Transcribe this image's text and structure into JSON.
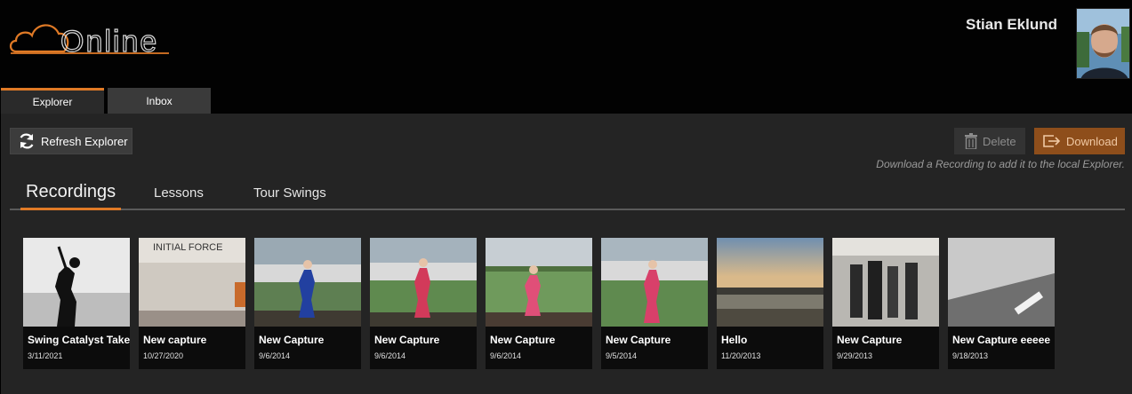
{
  "app": {
    "logo_text": "Online"
  },
  "user": {
    "name": "Stian Eklund"
  },
  "tabs": [
    {
      "label": "Explorer",
      "active": true
    },
    {
      "label": "Inbox",
      "active": false
    }
  ],
  "toolbar": {
    "refresh_label": "Refresh Explorer",
    "delete_label": "Delete",
    "download_label": "Download",
    "hint": "Download a Recording to add it to the local Explorer."
  },
  "subtabs": [
    {
      "label": "Recordings",
      "active": true
    },
    {
      "label": "Lessons",
      "active": false
    },
    {
      "label": "Tour Swings",
      "active": false
    }
  ],
  "recordings": [
    {
      "title": "Swing Catalyst Take",
      "date": "3/11/2021"
    },
    {
      "title": "New capture",
      "date": "10/27/2020",
      "thumb_text": "INITIAL FORCE"
    },
    {
      "title": "New Capture",
      "date": "9/6/2014"
    },
    {
      "title": "New Capture",
      "date": "9/6/2014"
    },
    {
      "title": "New Capture",
      "date": "9/6/2014"
    },
    {
      "title": "New Capture",
      "date": "9/5/2014"
    },
    {
      "title": "Hello",
      "date": "11/20/2013"
    },
    {
      "title": "New Capture",
      "date": "9/29/2013"
    },
    {
      "title": "New Capture eeeee",
      "date": "9/18/2013"
    }
  ],
  "colors": {
    "accent": "#e07a26",
    "download_bg": "#8e4e1b",
    "panel": "#242424"
  }
}
